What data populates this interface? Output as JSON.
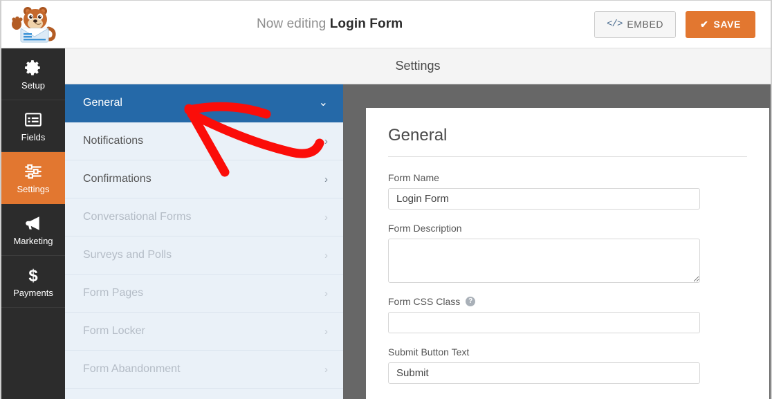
{
  "header": {
    "logo_icon": "wpforms-mascot-logo",
    "title_prefix": "Now editing",
    "title_form_name": "Login Form",
    "embed_button": "EMBED",
    "embed_icon": "code-icon",
    "save_button": "SAVE",
    "save_icon": "check-icon",
    "accent_orange": "#e27730"
  },
  "rail": {
    "items": [
      {
        "label": "Setup",
        "icon": "gear-icon",
        "active": false
      },
      {
        "label": "Fields",
        "icon": "list-icon",
        "active": false
      },
      {
        "label": "Settings",
        "icon": "sliders-icon",
        "active": true
      },
      {
        "label": "Marketing",
        "icon": "megaphone-icon",
        "active": false
      },
      {
        "label": "Payments",
        "icon": "dollar-icon",
        "active": false
      }
    ]
  },
  "panel": {
    "topbar_title": "Settings",
    "menu": [
      {
        "label": "General",
        "state": "active",
        "chevron": "chevron-down"
      },
      {
        "label": "Notifications",
        "state": "enabled",
        "chevron": "chevron-right"
      },
      {
        "label": "Confirmations",
        "state": "enabled",
        "chevron": "chevron-right"
      },
      {
        "label": "Conversational Forms",
        "state": "disabled",
        "chevron": "chevron-right"
      },
      {
        "label": "Surveys and Polls",
        "state": "disabled",
        "chevron": "chevron-right"
      },
      {
        "label": "Form Pages",
        "state": "disabled",
        "chevron": "chevron-right"
      },
      {
        "label": "Form Locker",
        "state": "disabled",
        "chevron": "chevron-right"
      },
      {
        "label": "Form Abandonment",
        "state": "disabled",
        "chevron": "chevron-right"
      }
    ],
    "active_blue": "#2569a8"
  },
  "content": {
    "heading": "General",
    "fields": [
      {
        "label": "Form Name",
        "type": "text",
        "value": "Login Form",
        "placeholder": "",
        "help": false
      },
      {
        "label": "Form Description",
        "type": "textarea",
        "value": "",
        "placeholder": "",
        "help": false
      },
      {
        "label": "Form CSS Class",
        "type": "text",
        "value": "",
        "placeholder": "",
        "help": true,
        "help_glyph": "?"
      },
      {
        "label": "Submit Button Text",
        "type": "text",
        "value": "Submit",
        "placeholder": "",
        "help": false
      }
    ]
  },
  "annotation": {
    "type": "arrow",
    "color": "#fb0d09",
    "points_to": "notifications-chevron"
  }
}
